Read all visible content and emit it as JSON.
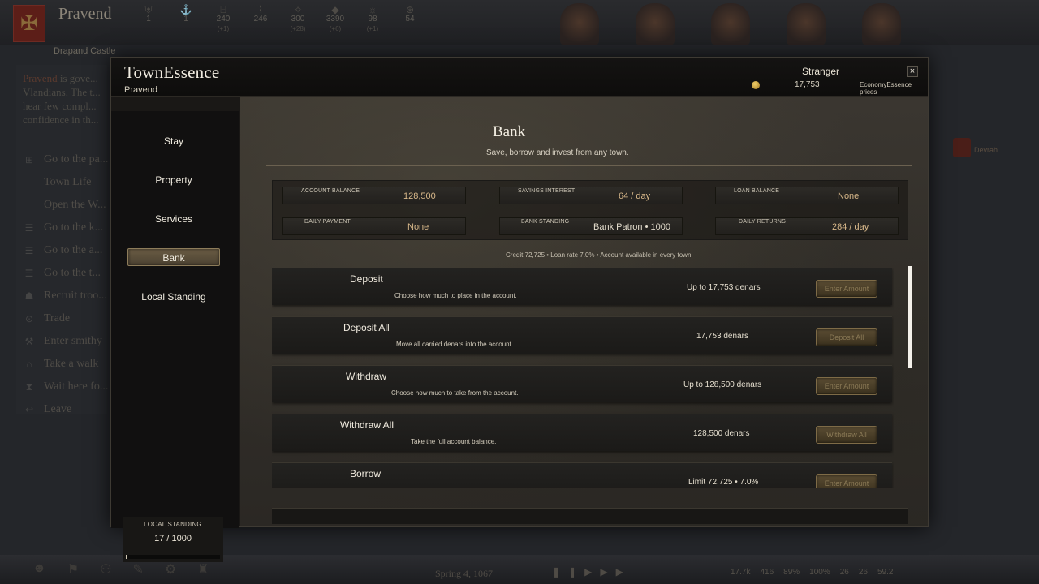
{
  "background": {
    "town": "Pravend",
    "subtitle": "Drapand Castle",
    "description_town": "Pravend",
    "description_rest": "is gove... Vlandians. The t... hear few compl... confidence in th...",
    "stats": [
      {
        "value": "1",
        "sub": ""
      },
      {
        "value": "1",
        "sub": ""
      },
      {
        "value": "240",
        "sub": "(+1)"
      },
      {
        "value": "246",
        "sub": ""
      },
      {
        "value": "300",
        "sub": "(+28)"
      },
      {
        "value": "3390",
        "sub": "(+6)"
      },
      {
        "value": "98",
        "sub": "(+1)"
      },
      {
        "value": "54",
        "sub": ""
      }
    ],
    "menu": [
      "Go to the pa...",
      "Town Life",
      "Open the W...",
      "Go to the k...",
      "Go to the a...",
      "Go to the t...",
      "Recruit troo...",
      "Trade",
      "Enter smithy",
      "Take a walk",
      "Wait here fo...",
      "Leave"
    ],
    "date": "Spring 4, 1067",
    "bottom_stats": [
      "17.7k",
      "416",
      "89%",
      "100%",
      "26",
      "26",
      "59.2"
    ],
    "right_label": "Devrah..."
  },
  "dialog": {
    "title": "TownEssence",
    "subtitle": "Pravend",
    "player": "Stranger",
    "gold": "17,753",
    "price_label": "EconomyEssence prices",
    "close": "×"
  },
  "nav": {
    "items": [
      "Stay",
      "Property",
      "Services",
      "Bank",
      "Local Standing"
    ],
    "active": "Bank"
  },
  "standing": {
    "label": "LOCAL STANDING",
    "value": "17 / 1000",
    "fill_fraction": 0.017
  },
  "bank": {
    "title": "Bank",
    "subtitle": "Save, borrow and invest from any town.",
    "stats": [
      {
        "label": "ACCOUNT BALANCE",
        "value": "128,500"
      },
      {
        "label": "SAVINGS INTEREST",
        "value": "64 / day"
      },
      {
        "label": "LOAN BALANCE",
        "value": "None"
      },
      {
        "label": "DAILY PAYMENT",
        "value": "None"
      },
      {
        "label": "BANK STANDING",
        "value": "Bank Patron • 1000"
      },
      {
        "label": "DAILY RETURNS",
        "value": "284 / day"
      }
    ],
    "info": "Credit 72,725 • Loan rate 7.0% • Account available in every town",
    "actions": [
      {
        "title": "Deposit",
        "desc": "Choose how much to place in the account.",
        "amount": "Up to 17,753 denars",
        "button": "Enter Amount"
      },
      {
        "title": "Deposit All",
        "desc": "Move all carried denars into the account.",
        "amount": "17,753 denars",
        "button": "Deposit All"
      },
      {
        "title": "Withdraw",
        "desc": "Choose how much to take from the account.",
        "amount": "Up to 128,500 denars",
        "button": "Enter Amount"
      },
      {
        "title": "Withdraw All",
        "desc": "Take the full account balance.",
        "amount": "128,500 denars",
        "button": "Withdraw All"
      },
      {
        "title": "Borrow",
        "desc": "",
        "amount": "Limit 72,725 • 7.0%",
        "button": "Enter Amount"
      }
    ]
  }
}
